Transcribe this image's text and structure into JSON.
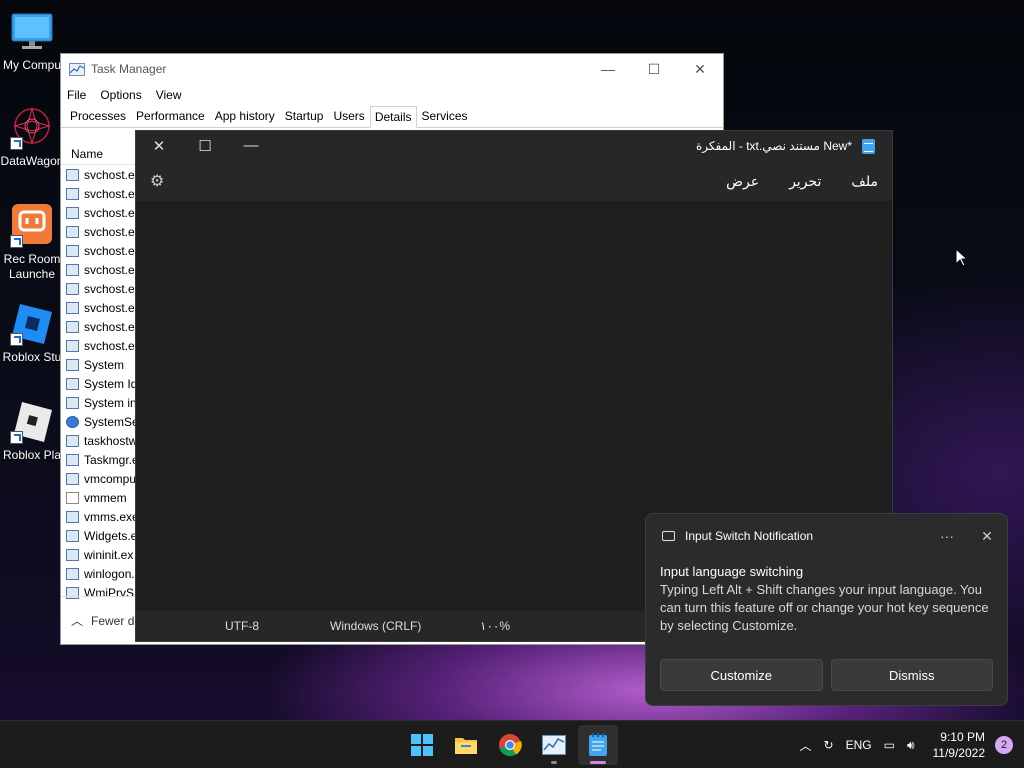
{
  "desktop": {
    "icons": [
      {
        "label": "My Compu",
        "icon": "monitor-icon"
      },
      {
        "label": "DataWagon",
        "icon": "datawagon-icon"
      },
      {
        "label": "Rec Room Launcher",
        "line1": "Rec Room",
        "line2": "Launche",
        "icon": "rec-room-icon"
      },
      {
        "label": "Roblox Stu",
        "icon": "roblox-studio-icon"
      },
      {
        "label": "Roblox Pla",
        "icon": "roblox-player-icon"
      }
    ]
  },
  "task_manager": {
    "title": "Task Manager",
    "menu": [
      "File",
      "Options",
      "View"
    ],
    "tabs": [
      "Processes",
      "Performance",
      "App history",
      "Startup",
      "Users",
      "Details",
      "Services"
    ],
    "active_tab": "Details",
    "column_header": "Name",
    "rows": [
      {
        "name": "svchost.ex",
        "icon": "process-icon"
      },
      {
        "name": "svchost.ex",
        "icon": "process-icon"
      },
      {
        "name": "svchost.ex",
        "icon": "process-icon"
      },
      {
        "name": "svchost.ex",
        "icon": "process-icon"
      },
      {
        "name": "svchost.ex",
        "icon": "process-icon"
      },
      {
        "name": "svchost.ex",
        "icon": "process-icon"
      },
      {
        "name": "svchost.ex",
        "icon": "process-icon"
      },
      {
        "name": "svchost.ex",
        "icon": "process-icon"
      },
      {
        "name": "svchost.ex",
        "icon": "process-icon"
      },
      {
        "name": "svchost.ex",
        "icon": "process-icon"
      },
      {
        "name": "System",
        "icon": "process-icon"
      },
      {
        "name": "System Idl",
        "icon": "process-icon"
      },
      {
        "name": "System int",
        "icon": "process-icon"
      },
      {
        "name": "SystemSet",
        "icon": "gear-icon"
      },
      {
        "name": "taskhostw",
        "icon": "process-icon"
      },
      {
        "name": "Taskmgr.e",
        "icon": "taskmgr-icon"
      },
      {
        "name": "vmcompu",
        "icon": "process-icon"
      },
      {
        "name": "vmmem",
        "icon": "page-icon"
      },
      {
        "name": "vmms.exe",
        "icon": "process-icon"
      },
      {
        "name": "Widgets.e",
        "icon": "process-icon"
      },
      {
        "name": "wininit.ex",
        "icon": "process-icon"
      },
      {
        "name": "winlogon.",
        "icon": "process-icon"
      },
      {
        "name": "WmiPrvSE",
        "icon": "process-icon"
      }
    ],
    "footer_label": "Fewer d"
  },
  "notepad": {
    "title": "*New مستند نصي.txt - المفكرة",
    "menu": [
      "ملف",
      "تحرير",
      "عرض"
    ],
    "status": {
      "encoding": "UTF-8",
      "line_ending": "Windows (CRLF)",
      "zoom": "١٠٠%"
    }
  },
  "notification": {
    "app_name": "Input Switch Notification",
    "heading": "Input language switching",
    "body": "Typing Left Alt + Shift changes your input language. You can turn this feature off or change your hot key sequence by selecting Customize.",
    "buttons": {
      "customize": "Customize",
      "dismiss": "Dismiss"
    },
    "more_glyph": "···",
    "close_glyph": "✕"
  },
  "taskbar": {
    "apps": [
      "start-icon",
      "file-explorer-icon",
      "chrome-icon",
      "task-manager-icon",
      "notepad-icon"
    ],
    "language": "ENG",
    "time": "9:10 PM",
    "date": "11/9/2022",
    "notification_count": "2",
    "accent": "#d085e8"
  }
}
